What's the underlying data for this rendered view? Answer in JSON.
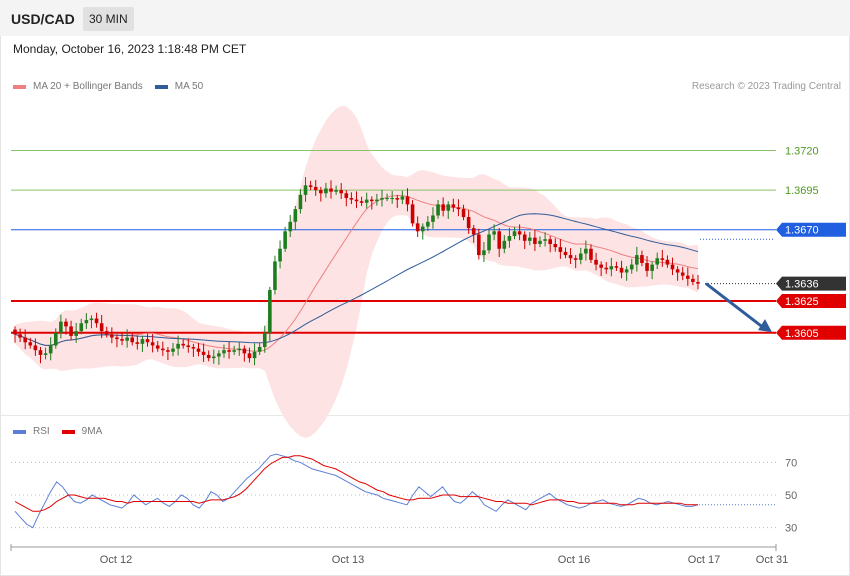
{
  "header": {
    "symbol": "USD/CAD",
    "timeframe": "30 MIN",
    "datetime": "Monday, October 16, 2023 1:18:48 PM CET"
  },
  "main_legend": {
    "items": [
      {
        "label": "MA 20 + Bollinger Bands",
        "color": "#f08080"
      },
      {
        "label": "MA 50",
        "color": "#2f5c9a"
      }
    ],
    "credit": "Research © 2023 Trading Central"
  },
  "rsi_legend": {
    "items": [
      {
        "label": "RSI",
        "color": "#5b7fd6"
      },
      {
        "label": "9MA",
        "color": "#e00000"
      }
    ]
  },
  "colors": {
    "up": "#1e7d1e",
    "down": "#cc0000",
    "band": "#fde3e3",
    "resistance_green": "#8cc26a",
    "pivot_blue": "#1f5fe0",
    "support_red": "#e00000",
    "last_price": "#333333",
    "arrow": "#2f5c9a"
  },
  "chart_data": [
    {
      "type": "candlestick",
      "title": "USD/CAD 30 MIN",
      "ylim": [
        1.3555,
        1.3755
      ],
      "x_tick_labels": [
        "Oct 12",
        "Oct 13",
        "Oct 16",
        "Oct 17",
        "Oct 31"
      ],
      "series": [
        {
          "name": "MA 20 + Bollinger Bands"
        },
        {
          "name": "MA 50"
        }
      ],
      "levels": [
        {
          "value": 1.372,
          "label": "1.3720",
          "kind": "resistance"
        },
        {
          "value": 1.3695,
          "label": "1.3695",
          "kind": "resistance"
        },
        {
          "value": 1.367,
          "label": "1.3670",
          "kind": "pivot"
        },
        {
          "value": 1.3636,
          "label": "1.3636",
          "kind": "last"
        },
        {
          "value": 1.3625,
          "label": "1.3625",
          "kind": "support"
        },
        {
          "value": 1.3605,
          "label": "1.3605",
          "kind": "support"
        }
      ],
      "close": [
        1.3604,
        1.3602,
        1.3599,
        1.3597,
        1.3594,
        1.3591,
        1.3592,
        1.3597,
        1.3605,
        1.3612,
        1.3609,
        1.3603,
        1.3606,
        1.3611,
        1.3613,
        1.3614,
        1.3611,
        1.3606,
        1.3604,
        1.3602,
        1.3601,
        1.36,
        1.3602,
        1.3599,
        1.3598,
        1.3601,
        1.3599,
        1.3597,
        1.3595,
        1.3594,
        1.3593,
        1.3595,
        1.3598,
        1.3597,
        1.3596,
        1.3595,
        1.3593,
        1.3591,
        1.3589,
        1.359,
        1.3592,
        1.3594,
        1.3593,
        1.3594,
        1.3595,
        1.3592,
        1.3589,
        1.3593,
        1.3596,
        1.3605,
        1.3632,
        1.365,
        1.3658,
        1.3669,
        1.3675,
        1.3683,
        1.3692,
        1.3698,
        1.3697,
        1.3695,
        1.3693,
        1.3696,
        1.3694,
        1.3695,
        1.3693,
        1.369,
        1.3689,
        1.3688,
        1.3687,
        1.3689,
        1.3688,
        1.3689,
        1.369,
        1.369,
        1.369,
        1.3689,
        1.3691,
        1.3686,
        1.3674,
        1.3669,
        1.3672,
        1.3675,
        1.3679,
        1.3686,
        1.3682,
        1.3686,
        1.3684,
        1.3683,
        1.3678,
        1.3671,
        1.3667,
        1.3654,
        1.3657,
        1.3667,
        1.3669,
        1.3658,
        1.3663,
        1.3666,
        1.3669,
        1.3667,
        1.3663,
        1.3665,
        1.3661,
        1.3663,
        1.3664,
        1.3661,
        1.3659,
        1.3656,
        1.3654,
        1.3652,
        1.3651,
        1.3655,
        1.3658,
        1.3651,
        1.3648,
        1.3646,
        1.3645,
        1.3647,
        1.3646,
        1.3643,
        1.3645,
        1.3648,
        1.3654,
        1.3649,
        1.3644,
        1.3648,
        1.3652,
        1.3651,
        1.3648,
        1.3645,
        1.3643,
        1.3641,
        1.3639,
        1.3637,
        1.3636
      ],
      "rsi": {
        "ylim": [
          20,
          80
        ],
        "ticks": [
          70,
          50,
          30
        ],
        "series": [
          {
            "name": "RSI",
            "values": [
              40,
              36,
              32,
              30,
              38,
              45,
              52,
              58,
              55,
              50,
              46,
              45,
              47,
              50,
              48,
              46,
              44,
              43,
              42,
              45,
              50,
              47,
              44,
              46,
              48,
              45,
              43,
              46,
              50,
              48,
              44,
              42,
              46,
              52,
              50,
              46,
              48,
              52,
              56,
              60,
              63,
              66,
              70,
              74,
              75,
              74,
              73,
              71,
              70,
              68,
              66,
              65,
              64,
              63,
              62,
              60,
              58,
              56,
              54,
              52,
              51,
              50,
              48,
              47,
              46,
              45,
              44,
              50,
              55,
              52,
              49,
              52,
              55,
              50,
              46,
              45,
              48,
              52,
              49,
              44,
              42,
              40,
              44,
              47,
              45,
              43,
              41,
              45,
              47,
              49,
              51,
              48,
              46,
              44,
              43,
              42,
              43,
              45,
              46,
              47,
              45,
              44,
              43,
              44,
              46,
              48,
              47,
              45,
              44,
              45,
              46,
              45,
              44,
              43,
              43,
              44
            ]
          },
          {
            "name": "9MA",
            "values": [
              46,
              44,
              42,
              40,
              40,
              41,
              43,
              46,
              48,
              50,
              50,
              49,
              48,
              48,
              48,
              48,
              47,
              46,
              46,
              45,
              46,
              46,
              46,
              46,
              46,
              46,
              46,
              46,
              46,
              46,
              46,
              45,
              46,
              47,
              47,
              47,
              48,
              49,
              51,
              54,
              58,
              62,
              66,
              69,
              71,
              73,
              73,
              74,
              74,
              73,
              72,
              70,
              68,
              67,
              66,
              64,
              62,
              60,
              58,
              57,
              55,
              53,
              52,
              50,
              49,
              48,
              47,
              47,
              48,
              48,
              48,
              49,
              50,
              50,
              50,
              49,
              49,
              49,
              49,
              48,
              47,
              46,
              46,
              45,
              45,
              45,
              45,
              44,
              45,
              46,
              47,
              47,
              47,
              46,
              46,
              45,
              45,
              45,
              45,
              45,
              45,
              45,
              44,
              44,
              44,
              45,
              45,
              45,
              45,
              45,
              45,
              45,
              45,
              44,
              44,
              44
            ]
          }
        ]
      }
    }
  ]
}
